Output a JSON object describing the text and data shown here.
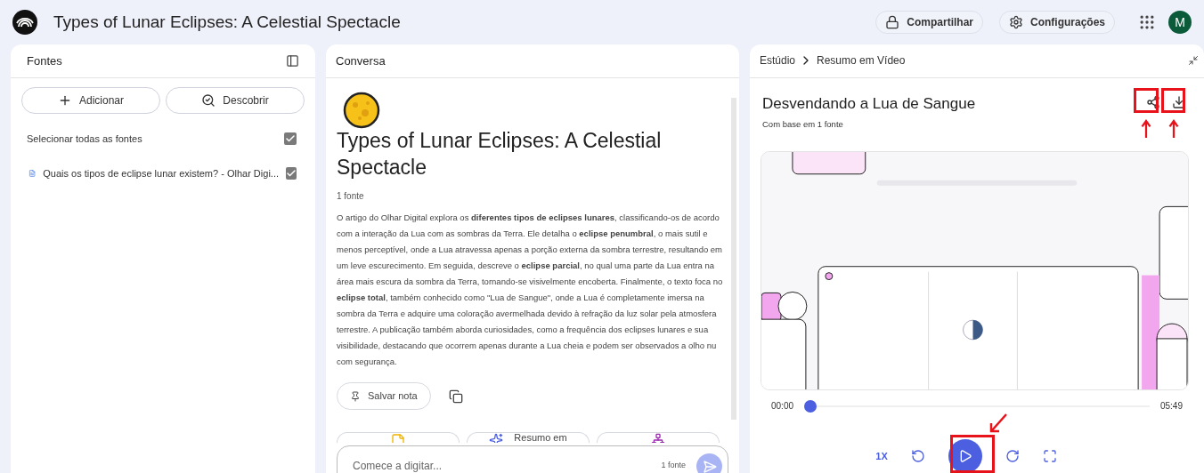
{
  "window": {
    "title": "Types of Lunar Eclipses: A Celestial Spectacle"
  },
  "topbar": {
    "buttons": [
      {
        "kind": "share",
        "label": "Compartilhar"
      },
      {
        "kind": "settings",
        "label": "Configurações"
      }
    ],
    "avatar": "M"
  },
  "sources": {
    "title": "Fontes",
    "buttons": [
      {
        "kind": "add",
        "label": "Adicionar"
      },
      {
        "kind": "discover",
        "label": "Descobrir"
      }
    ],
    "select_all": {
      "label": "Selecionar todas as fontes",
      "checked": true
    },
    "items": [
      {
        "label": "Quais os tipos de eclipse lunar existem? - Olhar Digi...",
        "checked": true
      }
    ]
  },
  "chat": {
    "title": "Conversa",
    "heading": "Types of Lunar Eclipses: A Celestial Spectacle",
    "source_count": "1 fonte",
    "summary": "O artigo do Olhar Digital explora os **diferentes tipos de eclipses lunares**, classificando-os de acordo com a interação da Lua com as sombras da Terra. Ele detalha o **eclipse penumbral**, o mais sutil e menos perceptível, onde a Lua atravessa apenas a porção externa da sombra terrestre, resultando em um leve escurecimento. Em seguida, descreve o **eclipse parcial**, no qual uma parte da Lua entra na área mais escura da sombra da Terra, tornando-se visivelmente encoberta. Finalmente, o texto foca no **eclipse total**, também conhecido como \"Lua de Sangue\", onde a Lua é completamente imersa na sombra da Terra e adquire uma coloração avermelhada devido à refração da luz solar pela atmosfera terrestre. A publicação também aborda curiosidades, como a frequência dos eclipses lunares e sua visibilidade, destacando que ocorrem apenas durante a Lua cheia e podem ser observados a olho nu com segurança.",
    "save_note": "Salvar nota",
    "chips": [
      {
        "kind": "note"
      },
      {
        "kind": "video",
        "label": "Resumo em"
      },
      {
        "kind": "mindmap"
      }
    ],
    "input": {
      "placeholder": "Comece a digitar...",
      "source_count": "1 fonte"
    }
  },
  "studio": {
    "breadcrumb": [
      "Estúdio",
      "Resumo em Vídeo"
    ],
    "title": "Desvendando a Lua de Sangue",
    "subtitle": "Com base em 1 fonte",
    "video": {
      "kind": "picture"
    },
    "player": {
      "elapsed": "00:00",
      "duration": "05:49",
      "level": 0,
      "speed": "1X"
    }
  }
}
